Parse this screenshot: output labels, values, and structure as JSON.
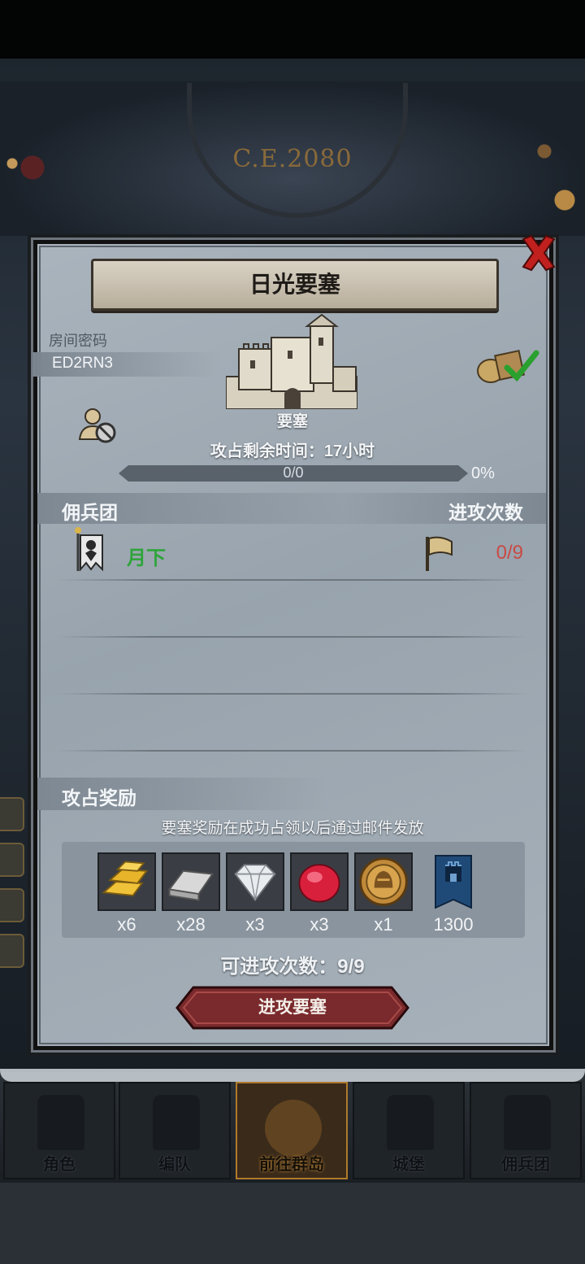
{
  "header": {
    "era": "C.E.2080"
  },
  "dialog": {
    "title": "日光要塞",
    "room_label": "房间密码",
    "room_code": "ED2RN3",
    "fortress_type": "要塞",
    "remaining_time": "攻占剩余时间：17小时",
    "progress_text": "0/0",
    "progress_percent": "0%",
    "progress_value": 0,
    "mercenary_label": "佣兵团",
    "attack_times_label": "进攻次数",
    "guild": {
      "name": "月下",
      "attacks": "0/9"
    },
    "reward_label": "攻占奖励",
    "reward_note": "要塞奖励在成功占领以后通过邮件发放",
    "rewards": [
      {
        "icon": "gold-bar-icon",
        "count": "x6"
      },
      {
        "icon": "silver-bar-icon",
        "count": "x28"
      },
      {
        "icon": "diamond-icon",
        "count": "x3"
      },
      {
        "icon": "ruby-icon",
        "count": "x3"
      },
      {
        "icon": "knight-medal-icon",
        "count": "x1"
      },
      {
        "icon": "guild-banner-icon",
        "count": "1300"
      }
    ],
    "available_attacks": "可进攻次数：9/9",
    "attack_button": "进攻要塞"
  },
  "bottom_nav": [
    {
      "label": "角色",
      "icon": "knight-icon"
    },
    {
      "label": "编队",
      "icon": "helmet-icon"
    },
    {
      "label": "前往群岛",
      "icon": "islands-icon",
      "active": true
    },
    {
      "label": "城堡",
      "icon": "castle-icon"
    },
    {
      "label": "佣兵团",
      "icon": "mercenary-ship-icon"
    }
  ],
  "colors": {
    "guild_name": "#2ea43a",
    "attack_count": "#c84a45",
    "button": "#7a2a2c"
  }
}
